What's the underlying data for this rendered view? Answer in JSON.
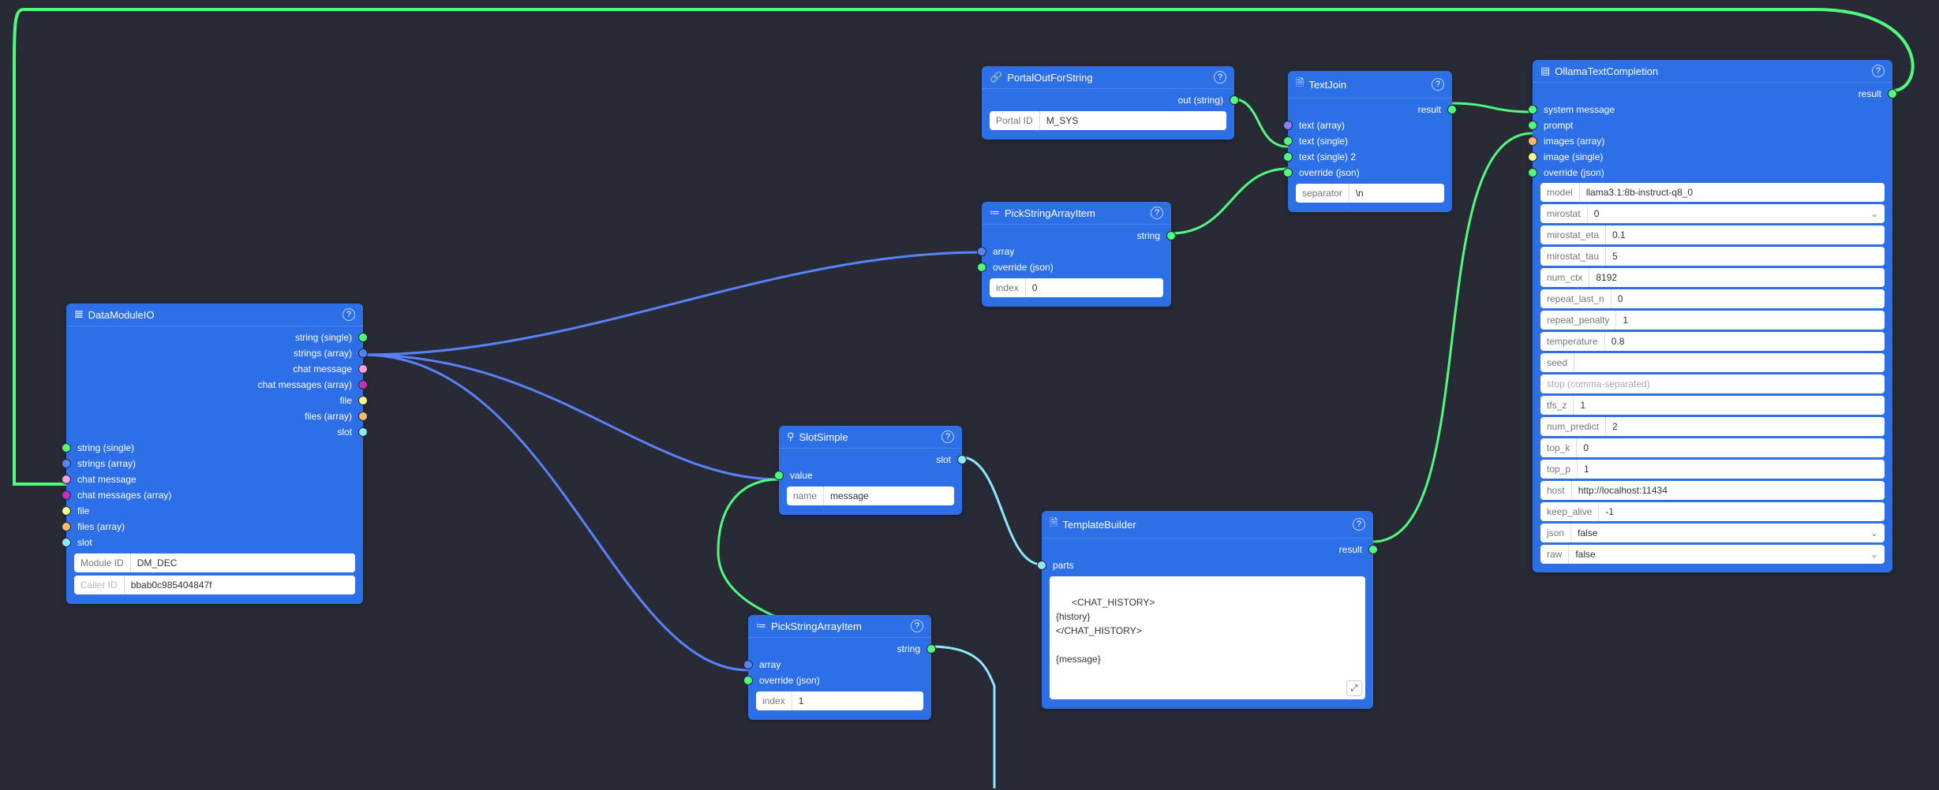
{
  "colors": {
    "edge_green": "#50fa7b",
    "edge_blue": "#5882fa",
    "edge_cyan": "#8be9fd"
  },
  "dataModule": {
    "title": "DataModuleIO",
    "outputs": [
      "string (single)",
      "strings (array)",
      "chat message",
      "chat messages (array)",
      "file",
      "files (array)",
      "slot"
    ],
    "inputs": [
      "string (single)",
      "strings (array)",
      "chat message",
      "chat messages (array)",
      "file",
      "files (array)",
      "slot"
    ],
    "module_id_label": "Module ID",
    "module_id_value": "DM_DEC",
    "caller_id_label": "Caller ID",
    "caller_id_value": "bbab0c985404847f"
  },
  "portalOut": {
    "title": "PortalOutForString",
    "out_label": "out (string)",
    "portal_id_label": "Portal ID",
    "portal_id_value": "M_SYS"
  },
  "pick1": {
    "title": "PickStringArrayItem",
    "out_label": "string",
    "in_array": "array",
    "in_override": "override (json)",
    "index_label": "index",
    "index_value": "0"
  },
  "pick2": {
    "title": "PickStringArrayItem",
    "out_label": "string",
    "in_array": "array",
    "in_override": "override (json)",
    "index_label": "index",
    "index_value": "1"
  },
  "slot": {
    "title": "SlotSimple",
    "out_label": "slot",
    "in_value": "value",
    "name_label": "name",
    "name_value": "message"
  },
  "textJoin": {
    "title": "TextJoin",
    "out_label": "result",
    "in_array": "text (array)",
    "in_single": "text (single)",
    "in_single2": "text (single) 2",
    "in_override": "override (json)",
    "sep_label": "separator",
    "sep_value": "\\n"
  },
  "template": {
    "title": "TemplateBuilder",
    "out_label": "result",
    "in_parts": "parts",
    "body": "<CHAT_HISTORY>\n{history}\n</CHAT_HISTORY>\n\n{message}"
  },
  "ollama": {
    "title": "OllamaTextCompletion",
    "out_label": "result",
    "in_sys": "system message",
    "in_prompt": "prompt",
    "in_imgs": "images (array)",
    "in_img": "image (single)",
    "in_override": "override (json)",
    "fields": {
      "model": {
        "label": "model",
        "value": "llama3.1:8b-instruct-q8_0"
      },
      "mirostat": {
        "label": "mirostat",
        "value": "0",
        "dropdown": true
      },
      "mirostat_eta": {
        "label": "mirostat_eta",
        "value": "0.1"
      },
      "mirostat_tau": {
        "label": "mirostat_tau",
        "value": "5"
      },
      "num_ctx": {
        "label": "num_ctx",
        "value": "8192"
      },
      "repeat_last_n": {
        "label": "repeat_last_n",
        "value": "0"
      },
      "repeat_penalty": {
        "label": "repeat_penalty",
        "value": "1"
      },
      "temperature": {
        "label": "temperature",
        "value": "0.8"
      },
      "seed": {
        "label": "seed",
        "value": ""
      },
      "stop": {
        "label": "",
        "value": "",
        "placeholder": "stop (comma-separated)"
      },
      "tfs_z": {
        "label": "tfs_z",
        "value": "1"
      },
      "num_predict": {
        "label": "num_predict",
        "value": "2"
      },
      "top_k": {
        "label": "top_k",
        "value": "0"
      },
      "top_p": {
        "label": "top_p",
        "value": "1"
      },
      "host": {
        "label": "host",
        "value": "http://localhost:11434"
      },
      "keep_alive": {
        "label": "keep_alive",
        "value": "-1"
      },
      "json": {
        "label": "json",
        "value": "false",
        "dropdown": true
      },
      "raw": {
        "label": "raw",
        "value": "false",
        "dropdown": true
      }
    }
  }
}
